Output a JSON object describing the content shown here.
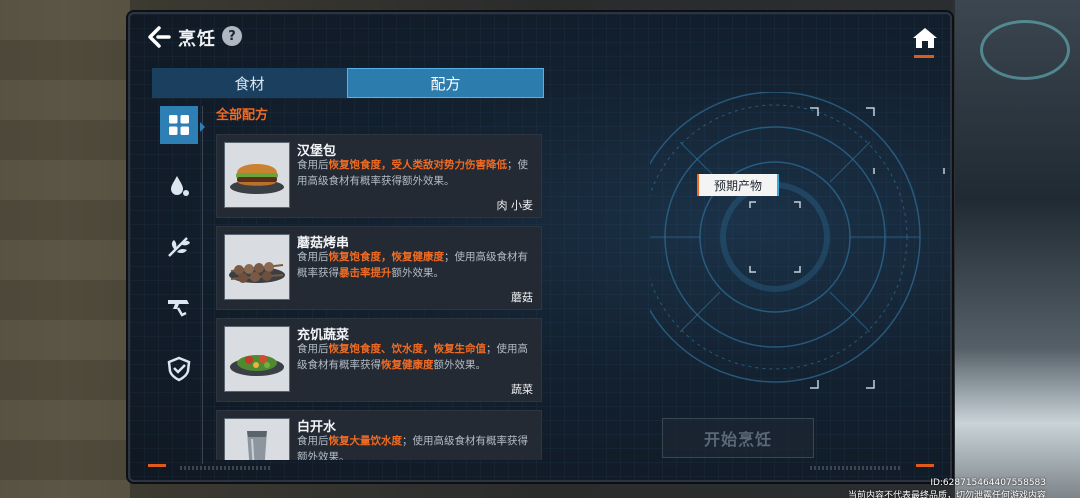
{
  "header": {
    "title": "烹饪",
    "help": "?"
  },
  "tabs": [
    {
      "label": "食材",
      "active": false
    },
    {
      "label": "配方",
      "active": true
    }
  ],
  "section_label": "全部配方",
  "categories": [
    {
      "icon": "grid-icon",
      "active": true
    },
    {
      "icon": "water-drop-icon",
      "active": false
    },
    {
      "icon": "herb-icon",
      "active": false
    },
    {
      "icon": "gun-icon",
      "active": false
    },
    {
      "icon": "shield-icon",
      "active": false
    }
  ],
  "recipes": [
    {
      "name": "汉堡包",
      "desc_parts": [
        {
          "text": "食用后",
          "hl": false
        },
        {
          "text": "恢复饱食度，受人类敌对势力伤害降低",
          "hl": true
        },
        {
          "text": "；使用高级食材有概率获得额外效果。",
          "hl": false
        }
      ],
      "tag": "肉 小麦",
      "icon": "burger-icon"
    },
    {
      "name": "蘑菇烤串",
      "desc_parts": [
        {
          "text": "食用后",
          "hl": false
        },
        {
          "text": "恢复饱食度，恢复健康度",
          "hl": true
        },
        {
          "text": "；使用高级食材有概率获得",
          "hl": false
        },
        {
          "text": "暴击率提升",
          "hl": true
        },
        {
          "text": "额外效果。",
          "hl": false
        }
      ],
      "tag": "蘑菇",
      "icon": "skewer-icon"
    },
    {
      "name": "充饥蔬菜",
      "desc_parts": [
        {
          "text": "食用后",
          "hl": false
        },
        {
          "text": "恢复饱食度、饮水度，恢复生命值",
          "hl": true
        },
        {
          "text": "；使用高级食材有概率获得",
          "hl": false
        },
        {
          "text": "恢复健康度",
          "hl": true
        },
        {
          "text": "额外效果。",
          "hl": false
        }
      ],
      "tag": "蔬菜",
      "icon": "salad-icon"
    },
    {
      "name": "白开水",
      "desc_parts": [
        {
          "text": "食用后",
          "hl": false
        },
        {
          "text": "恢复大量饮水度",
          "hl": true
        },
        {
          "text": "；使用高级食材有概率获得额外效果。",
          "hl": false
        }
      ],
      "tag": "",
      "icon": "cup-icon"
    }
  ],
  "result": {
    "label": "预期产物"
  },
  "start_button": {
    "label": "开始烹饪",
    "enabled": false
  },
  "watermark": {
    "id": "ID:628715464407558583",
    "notice": "当前内容不代表最终品质，切勿泄露任何游戏内容"
  },
  "colors": {
    "accent": "#ef6a22",
    "tab_active": "#2d7cae",
    "highlight": "#ef6a22"
  }
}
